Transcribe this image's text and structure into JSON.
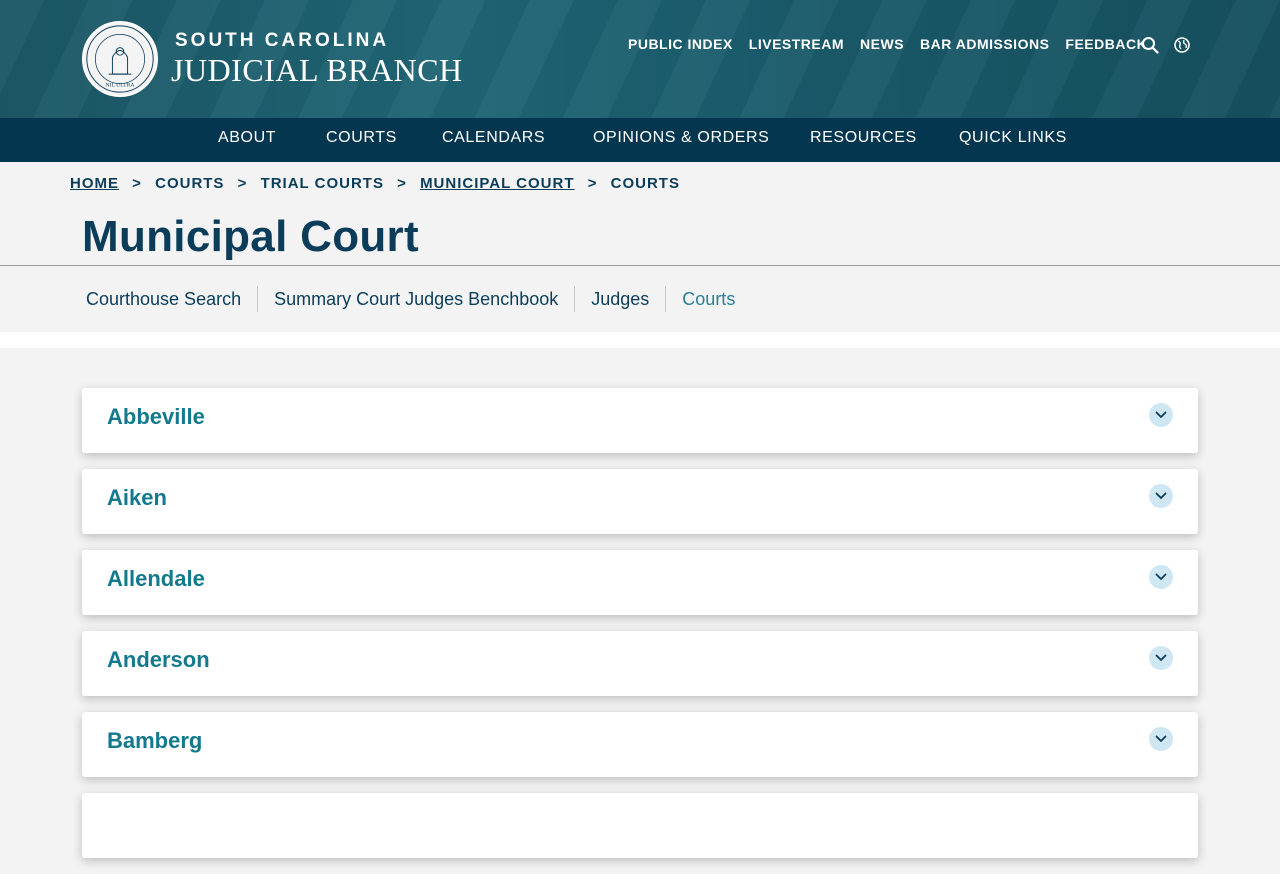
{
  "brand": {
    "top": "SOUTH CAROLINA",
    "main": "JUDICIAL BRANCH",
    "seal_text": "NIL ULTRA"
  },
  "utility_nav": [
    "PUBLIC INDEX",
    "LIVESTREAM",
    "NEWS",
    "BAR ADMISSIONS",
    "FEEDBACK"
  ],
  "utility_icons": [
    "search-icon",
    "globe-icon"
  ],
  "main_nav": [
    "ABOUT",
    "COURTS",
    "CALENDARS",
    "OPINIONS & ORDERS",
    "RESOURCES",
    "QUICK LINKS"
  ],
  "breadcrumb": [
    {
      "label": "HOME",
      "link": true
    },
    {
      "label": "COURTS",
      "link": false
    },
    {
      "label": "TRIAL COURTS",
      "link": false
    },
    {
      "label": "MUNICIPAL COURT",
      "link": true
    },
    {
      "label": "COURTS",
      "link": false
    }
  ],
  "breadcrumb_sep": ">",
  "page_title": "Municipal Court",
  "sub_nav": [
    {
      "label": "Courthouse Search",
      "active": false
    },
    {
      "label": "Summary Court Judges Benchbook",
      "active": false
    },
    {
      "label": "Judges",
      "active": false
    },
    {
      "label": "Courts",
      "active": true
    }
  ],
  "accordion": [
    "Abbeville",
    "Aiken",
    "Allendale",
    "Anderson",
    "Bamberg"
  ],
  "colors": {
    "header": "#1c5766",
    "mainnav": "#053650",
    "title": "#0b3d5a",
    "accent": "#137a8d",
    "toggle_bg": "#cfe6f3"
  }
}
